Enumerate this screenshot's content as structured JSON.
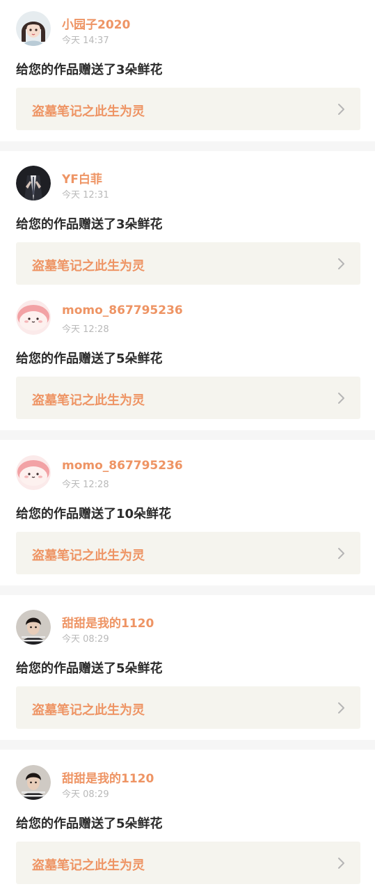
{
  "notifications": [
    {
      "username": "小园子2020",
      "time": "今天 14:37",
      "message": "给您的作品赠送了3朵鲜花",
      "work_title": "盗墓笔记之此生为灵",
      "avatar": "girl-avatar"
    },
    {
      "username": "YF白菲",
      "time": "今天 12:31",
      "message": "给您的作品赠送了3朵鲜花",
      "work_title": "盗墓笔记之此生为灵",
      "avatar": "dark-suit-avatar"
    },
    {
      "username": "momo_867795236",
      "time": "今天 12:28",
      "message": "给您的作品赠送了5朵鲜花",
      "work_title": "盗墓笔记之此生为灵",
      "avatar": "pink-blob-avatar"
    },
    {
      "username": "momo_867795236",
      "time": "今天 12:28",
      "message": "给您的作品赠送了10朵鲜花",
      "work_title": "盗墓笔记之此生为灵",
      "avatar": "pink-blob-avatar"
    },
    {
      "username": "甜甜是我的1120",
      "time": "今天 08:29",
      "message": "给您的作品赠送了5朵鲜花",
      "work_title": "盗墓笔记之此生为灵",
      "avatar": "boy-striped-avatar"
    },
    {
      "username": "甜甜是我的1120",
      "time": "今天 08:29",
      "message": "给您的作品赠送了5朵鲜花",
      "work_title": "盗墓笔记之此生为灵",
      "avatar": "boy-striped-avatar"
    }
  ],
  "colors": {
    "name": "#ee9464",
    "time": "#b9b9b9",
    "message": "#2b2b2b",
    "card_bg": "#f5f4ee",
    "separator": "#f6f6f6"
  },
  "icons": {
    "card_arrow": "chevron-right-icon"
  }
}
